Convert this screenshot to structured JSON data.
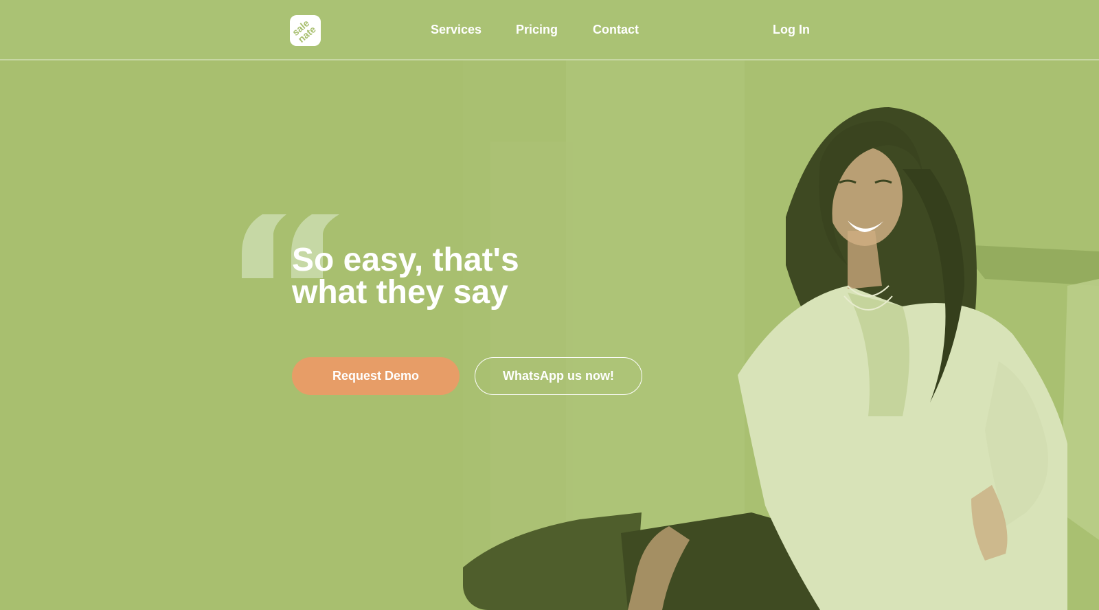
{
  "brand": {
    "logo_text": "sale nate",
    "logo_icon": "brand-logo-icon"
  },
  "nav": {
    "services": "Services",
    "pricing": "Pricing",
    "contact": "Contact",
    "login": "Log In"
  },
  "hero": {
    "quote_icon": "quote-mark-icon",
    "headline_line1": "So easy, that's",
    "headline_line2": "what they say",
    "cta_primary": "Request Demo",
    "cta_secondary": "WhatsApp us now!",
    "photo": "smiling-woman-photo"
  },
  "colors": {
    "background": "#a8bf6f",
    "primary_button": "#e79d67",
    "text": "#ffffff"
  }
}
